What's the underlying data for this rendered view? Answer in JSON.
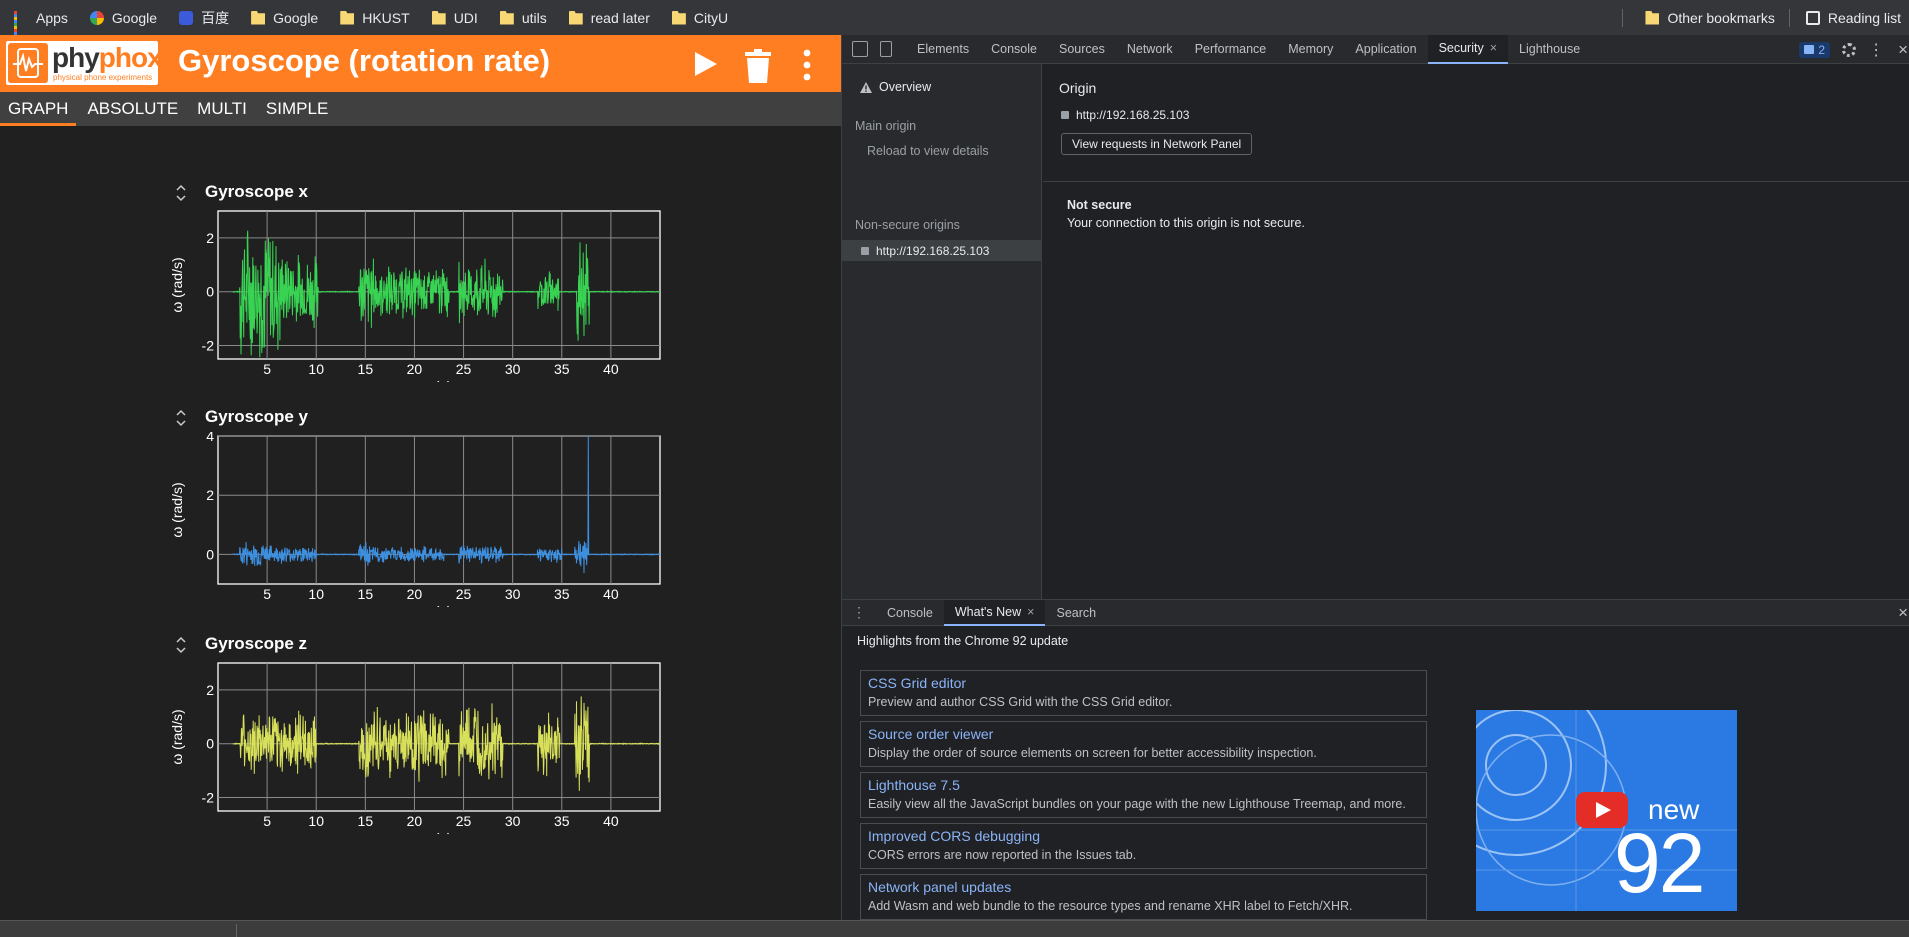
{
  "bookmarks": {
    "items": [
      {
        "label": "Apps",
        "icon": "apps-grid-icon"
      },
      {
        "label": "Google",
        "icon": "google-icon"
      },
      {
        "label": "百度",
        "icon": "baidu-icon"
      },
      {
        "label": "Google",
        "icon": "folder-icon"
      },
      {
        "label": "HKUST",
        "icon": "folder-icon"
      },
      {
        "label": "UDI",
        "icon": "folder-icon"
      },
      {
        "label": "utils",
        "icon": "folder-icon"
      },
      {
        "label": "read later",
        "icon": "folder-icon"
      },
      {
        "label": "CityU",
        "icon": "folder-icon"
      }
    ],
    "other": "Other bookmarks",
    "reading_list": "Reading list"
  },
  "phyphox": {
    "logo_word_a": "phy",
    "logo_word_b": "phox",
    "logo_sub": "physical phone experiments",
    "title": "Gyroscope (rotation rate)",
    "accent": "#ff7e22",
    "tabs": [
      "GRAPH",
      "ABSOLUTE",
      "MULTI",
      "SIMPLE"
    ],
    "active_tab": "GRAPH",
    "graphs": [
      {
        "title": "Gyroscope x",
        "ylabel": "ω (rad/s)",
        "xlabel": "t (s)",
        "color": "#39d353",
        "yticks": [
          "2",
          "0",
          "-2"
        ],
        "xticks": [
          "5",
          "10",
          "15",
          "20",
          "25",
          "30",
          "35",
          "40"
        ]
      },
      {
        "title": "Gyroscope y",
        "ylabel": "ω (rad/s)",
        "xlabel": "t (s)",
        "color": "#3d8fe0",
        "yticks": [
          "4",
          "2",
          "0"
        ],
        "xticks": [
          "5",
          "10",
          "15",
          "20",
          "25",
          "30",
          "35",
          "40"
        ]
      },
      {
        "title": "Gyroscope z",
        "ylabel": "ω (rad/s)",
        "xlabel": "t (s)",
        "color": "#d8e05a",
        "yticks": [
          "2",
          "0",
          "-2"
        ],
        "xticks": [
          "5",
          "10",
          "15",
          "20",
          "25",
          "30",
          "35",
          "40"
        ]
      }
    ]
  },
  "chart_data": [
    {
      "type": "line",
      "title": "Gyroscope x",
      "xlabel": "t (s)",
      "ylabel": "ω (rad/s)",
      "xlim": [
        0,
        45
      ],
      "ylim": [
        -2.5,
        3
      ],
      "bursts": [
        {
          "t0": 2.2,
          "t1": 6.5,
          "amp": 2.9
        },
        {
          "t0": 6.5,
          "t1": 10.2,
          "amp": 1.6
        },
        {
          "t0": 14.3,
          "t1": 16.2,
          "amp": 1.6
        },
        {
          "t0": 16.2,
          "t1": 23.5,
          "amp": 1.1
        },
        {
          "t0": 24.5,
          "t1": 29,
          "amp": 1.3
        },
        {
          "t0": 32.5,
          "t1": 34.7,
          "amp": 0.9
        },
        {
          "t0": 36.5,
          "t1": 37.8,
          "amp": 2.2
        }
      ]
    },
    {
      "type": "line",
      "title": "Gyroscope y",
      "xlabel": "t (s)",
      "ylabel": "ω (rad/s)",
      "xlim": [
        0,
        45
      ],
      "ylim": [
        -1,
        4
      ],
      "bursts": [
        {
          "t0": 2.2,
          "t1": 5,
          "amp": 0.5
        },
        {
          "t0": 5,
          "t1": 10,
          "amp": 0.35
        },
        {
          "t0": 14.3,
          "t1": 15.5,
          "amp": 0.5
        },
        {
          "t0": 15.5,
          "t1": 23,
          "amp": 0.3
        },
        {
          "t0": 24.5,
          "t1": 29,
          "amp": 0.35
        },
        {
          "t0": 32.5,
          "t1": 35,
          "amp": 0.3
        },
        {
          "t0": 36.3,
          "t1": 37.6,
          "amp": 0.7
        }
      ],
      "spike": {
        "t": 37.7,
        "value": 4
      }
    },
    {
      "type": "line",
      "title": "Gyroscope z",
      "xlabel": "t (s)",
      "ylabel": "ω (rad/s)",
      "xlim": [
        0,
        45
      ],
      "ylim": [
        -2.5,
        3
      ],
      "bursts": [
        {
          "t0": 2.2,
          "t1": 10,
          "amp": 1.3
        },
        {
          "t0": 14.3,
          "t1": 23.5,
          "amp": 1.5
        },
        {
          "t0": 24.5,
          "t1": 29,
          "amp": 1.6
        },
        {
          "t0": 32.5,
          "t1": 34.8,
          "amp": 1.4
        },
        {
          "t0": 36.3,
          "t1": 37.8,
          "amp": 2.7
        }
      ]
    }
  ],
  "devtools": {
    "tabs": [
      "Elements",
      "Console",
      "Sources",
      "Network",
      "Performance",
      "Memory",
      "Application",
      "Security",
      "Lighthouse"
    ],
    "active_tab": "Security",
    "issues_count": "2",
    "sidebar": {
      "overview": "Overview",
      "main_origin_heading": "Main origin",
      "main_origin_text": "Reload to view details",
      "nonsecure_heading": "Non-secure origins",
      "nonsecure_origin": "http://192.168.25.103"
    },
    "main": {
      "origin_label": "Origin",
      "origin_url": "http://192.168.25.103",
      "view_requests": "View requests in Network Panel",
      "status_title": "Not secure",
      "status_text": "Your connection to this origin is not secure."
    },
    "drawer": {
      "tabs": [
        "Console",
        "What's New",
        "Search"
      ],
      "active_tab": "What's New",
      "highlights": "Highlights from the Chrome 92 update",
      "items": [
        {
          "title": "CSS Grid editor",
          "desc": "Preview and author CSS Grid with the CSS Grid editor."
        },
        {
          "title": "Source order viewer",
          "desc": "Display the order of source elements on screen for better accessibility inspection."
        },
        {
          "title": "Lighthouse 7.5",
          "desc": "Easily view all the JavaScript bundles on your page with the new Lighthouse Treemap, and more."
        },
        {
          "title": "Improved CORS debugging",
          "desc": "CORS errors are now reported in the Issues tab."
        },
        {
          "title": "Network panel updates",
          "desc": "Add Wasm and web bundle to the resource types and rename XHR label to Fetch/XHR."
        }
      ],
      "video_new": "new",
      "video_num": "92"
    }
  }
}
